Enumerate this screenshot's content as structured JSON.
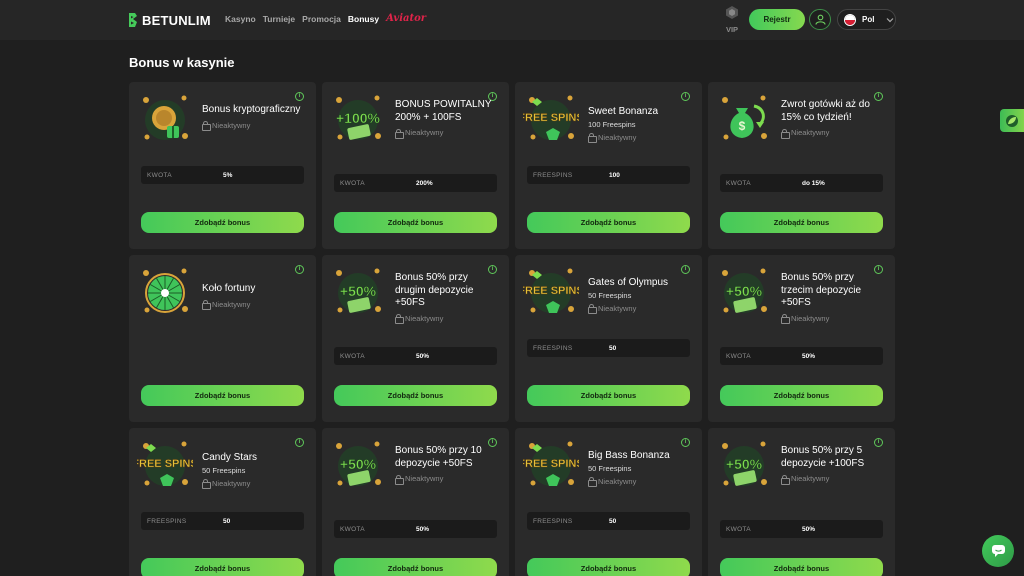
{
  "header": {
    "brand": "BETUNLIM",
    "nav": [
      {
        "label": "Kasyno",
        "active": false
      },
      {
        "label": "Turnieje",
        "active": false
      },
      {
        "label": "Promocja",
        "active": false
      },
      {
        "label": "Bonusy",
        "active": true
      },
      {
        "label": "Aviator",
        "active": false
      }
    ],
    "vip_label": "VIP",
    "register_label": "Rejestr",
    "language": "Pol"
  },
  "page_title": "Bonus w kasynie",
  "colors": {
    "accent_start": "#42c95b",
    "accent_end": "#86d94f",
    "card_bg": "#2a2a2a",
    "page_bg": "#1f1f1f"
  },
  "cards": [
    {
      "title": "Bonus kryptograficzny",
      "subtitle": "",
      "status": "Nieaktywny",
      "amount_label": "KWOTA",
      "amount_value": "5%",
      "button": "Zdobądź bonus",
      "art": "coins-gift-icon"
    },
    {
      "title": "BONUS POWITALNY 200% + 100FS",
      "subtitle": "",
      "status": "Nieaktywny",
      "amount_label": "KWOTA",
      "amount_value": "200%",
      "button": "Zdobądź bonus",
      "art": "percent-100-icon"
    },
    {
      "title": "Sweet Bonanza",
      "subtitle": "100 Freespins",
      "status": "Nieaktywny",
      "amount_label": "FREESPINS",
      "amount_value": "100",
      "button": "Zdobądź bonus",
      "art": "free-spins-icon"
    },
    {
      "title": "Zwrot gotówki aż do 15% co tydzień!",
      "subtitle": "",
      "status": "Nieaktywny",
      "amount_label": "KWOTA",
      "amount_value": "do 15%",
      "button": "Zdobądź bonus",
      "art": "money-bag-icon"
    },
    {
      "title": "Koło fortuny",
      "subtitle": "",
      "status": "Nieaktywny",
      "amount_label": "",
      "amount_value": "",
      "button": "Zdobądź bonus",
      "art": "fortune-wheel-icon"
    },
    {
      "title": "Bonus 50% przy drugim depozycie +50FS",
      "subtitle": "",
      "status": "Nieaktywny",
      "amount_label": "KWOTA",
      "amount_value": "50%",
      "button": "Zdobądź bonus",
      "art": "percent-50-icon"
    },
    {
      "title": "Gates of Olympus",
      "subtitle": "50 Freespins",
      "status": "Nieaktywny",
      "amount_label": "FREESPINS",
      "amount_value": "50",
      "button": "Zdobądź bonus",
      "art": "free-spins-icon"
    },
    {
      "title": "Bonus 50% przy trzecim depozycie +50FS",
      "subtitle": "",
      "status": "Nieaktywny",
      "amount_label": "KWOTA",
      "amount_value": "50%",
      "button": "Zdobądź bonus",
      "art": "percent-50-icon"
    },
    {
      "title": "Candy Stars",
      "subtitle": "50 Freespins",
      "status": "Nieaktywny",
      "amount_label": "FREESPINS",
      "amount_value": "50",
      "button": "Zdobądź bonus",
      "art": "free-spins-icon"
    },
    {
      "title": "Bonus 50% przy 10 depozycie +50FS",
      "subtitle": "",
      "status": "Nieaktywny",
      "amount_label": "KWOTA",
      "amount_value": "50%",
      "button": "Zdobądź bonus",
      "art": "percent-50-icon"
    },
    {
      "title": "Big Bass Bonanza",
      "subtitle": "50 Freespins",
      "status": "Nieaktywny",
      "amount_label": "FREESPINS",
      "amount_value": "50",
      "button": "Zdobądź bonus",
      "art": "free-spins-icon"
    },
    {
      "title": "Bonus 50% przy 5 depozycie +100FS",
      "subtitle": "",
      "status": "Nieaktywny",
      "amount_label": "KWOTA",
      "amount_value": "50%",
      "button": "Zdobądź bonus",
      "art": "percent-50-icon"
    }
  ],
  "art_text": {
    "percent_100": "+100%",
    "percent_50": "+50%",
    "free_spins_1": "FREE",
    "free_spins_2": "SPINS"
  }
}
